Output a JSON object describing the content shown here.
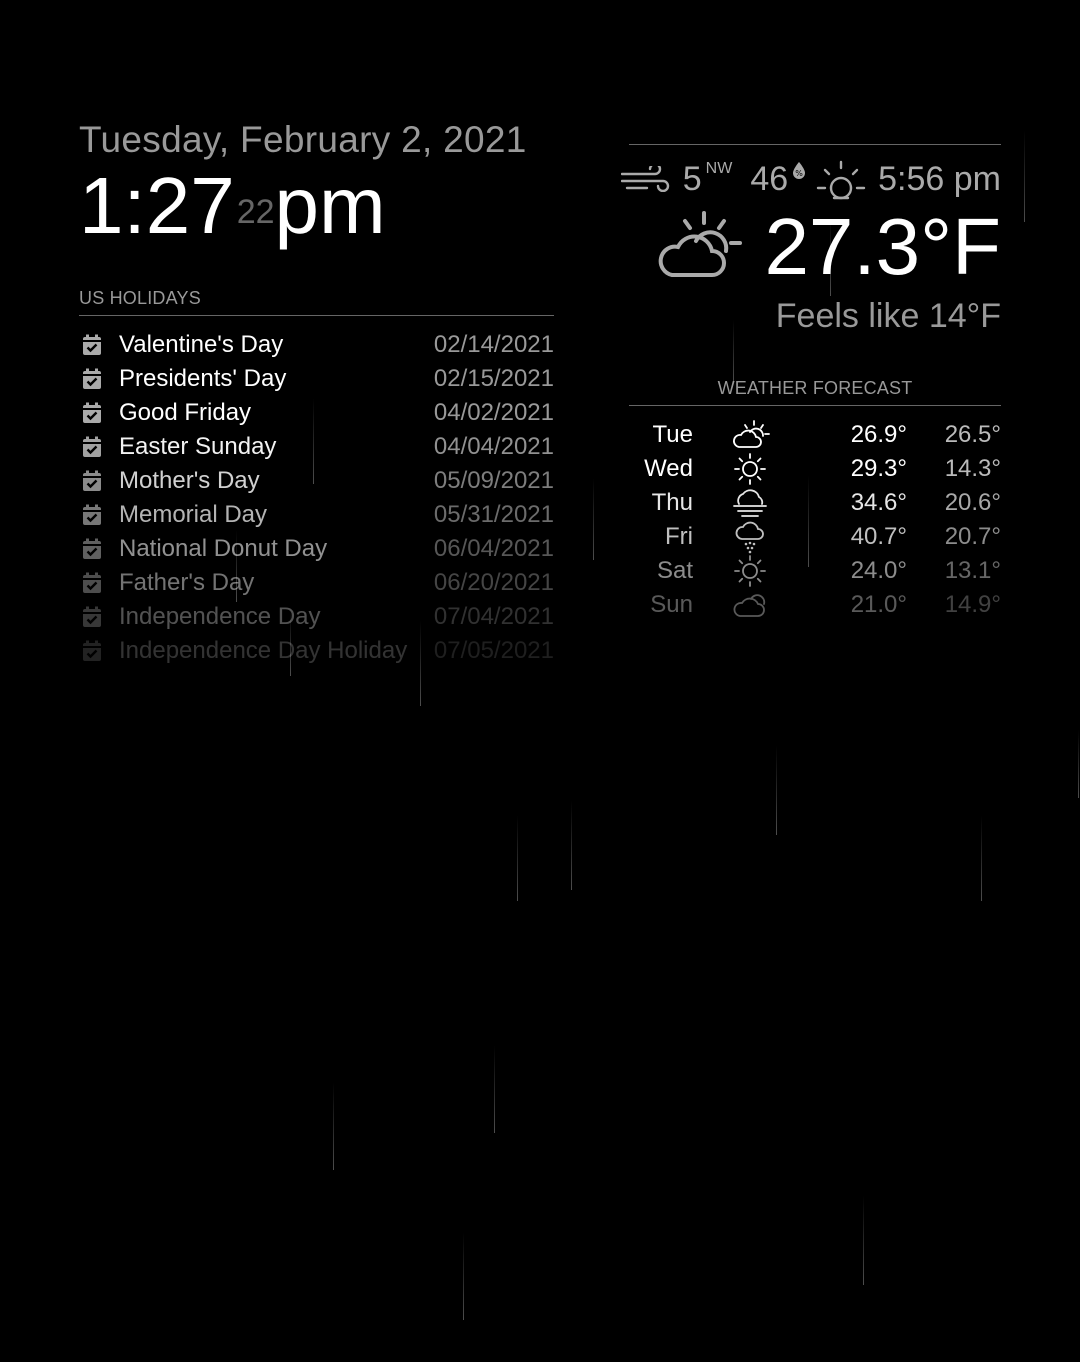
{
  "clock": {
    "date": "Tuesday, February 2, 2021",
    "hours_minutes": "1:27",
    "seconds": "22",
    "period": "pm"
  },
  "holidays": {
    "header": "US HOLIDAYS",
    "icon": "calendar-check-icon",
    "items": [
      {
        "title": "Valentine's Day",
        "date": "02/14/2021",
        "opacity": 1.0
      },
      {
        "title": "Presidents' Day",
        "date": "02/15/2021",
        "opacity": 1.0
      },
      {
        "title": "Good Friday",
        "date": "04/02/2021",
        "opacity": 1.0
      },
      {
        "title": "Easter Sunday",
        "date": "04/04/2021",
        "opacity": 0.95
      },
      {
        "title": "Mother's Day",
        "date": "05/09/2021",
        "opacity": 0.82
      },
      {
        "title": "Memorial Day",
        "date": "05/31/2021",
        "opacity": 0.7
      },
      {
        "title": "National Donut Day",
        "date": "06/04/2021",
        "opacity": 0.57
      },
      {
        "title": "Father's Day",
        "date": "06/20/2021",
        "opacity": 0.45
      },
      {
        "title": "Independence Day",
        "date": "07/04/2021",
        "opacity": 0.32
      },
      {
        "title": "Independence Day Holiday",
        "date": "07/05/2021",
        "opacity": 0.2
      }
    ]
  },
  "current_weather": {
    "wind_speed": "5",
    "wind_direction": "NW",
    "humidity": "46",
    "sunset_time": "5:56 pm",
    "icon": "partly-cloudy-day-icon",
    "temperature": "27.3°F",
    "feels_like": "Feels like 14°F"
  },
  "forecast": {
    "header": "WEATHER FORECAST",
    "days": [
      {
        "day": "Tue",
        "icon": "partly-cloudy-icon",
        "max": "26.9°",
        "min": "26.5°",
        "opacity": 1.0
      },
      {
        "day": "Wed",
        "icon": "sun-icon",
        "max": "29.3°",
        "min": "14.3°",
        "opacity": 1.0
      },
      {
        "day": "Thu",
        "icon": "fog-icon",
        "max": "34.6°",
        "min": "20.6°",
        "opacity": 0.9
      },
      {
        "day": "Fri",
        "icon": "snow-icon",
        "max": "40.7°",
        "min": "20.7°",
        "opacity": 0.75
      },
      {
        "day": "Sat",
        "icon": "sun-icon",
        "max": "24.0°",
        "min": "13.1°",
        "opacity": 0.55
      },
      {
        "day": "Sun",
        "icon": "cloud-icon",
        "max": "21.0°",
        "min": "14.9°",
        "opacity": 0.35
      }
    ]
  },
  "colors": {
    "background": "#000000",
    "bright": "#ffffff",
    "normal": "#aaaaaa",
    "dimmed": "#666666"
  }
}
